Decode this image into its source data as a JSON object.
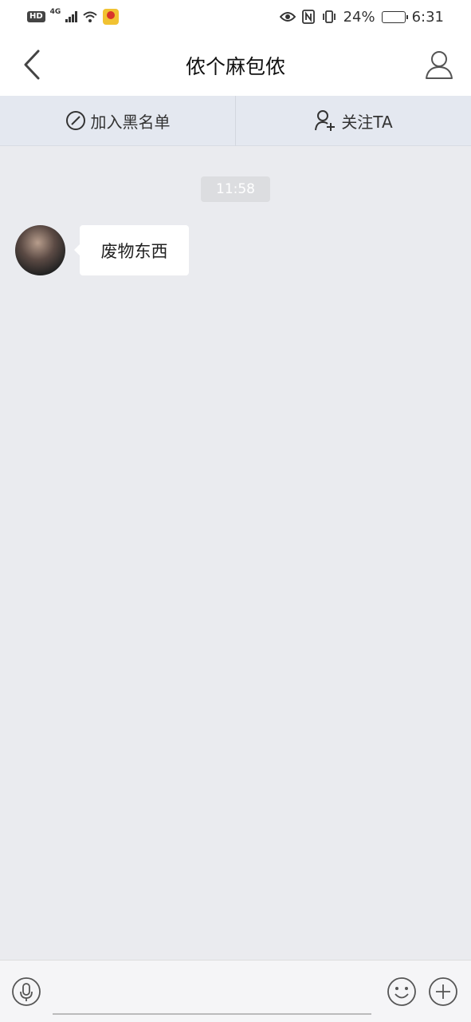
{
  "status_bar": {
    "hd_label": "HD",
    "network_label": "4G",
    "battery_percent": "24%",
    "battery_level": 0.24,
    "time": "6:31"
  },
  "header": {
    "title": "侬个麻包侬",
    "back_icon": "chevron-left-icon",
    "profile_icon": "user-outline-icon"
  },
  "actions": {
    "blacklist_label": "加入黑名单",
    "blacklist_icon": "ban-circle-icon",
    "follow_label": "关注TA",
    "follow_icon": "user-plus-icon"
  },
  "chat": {
    "timestamp": "11:58",
    "messages": [
      {
        "sender": "other",
        "text": "废物东西"
      }
    ]
  },
  "input_bar": {
    "voice_icon": "microphone-icon",
    "emoji_icon": "smiley-icon",
    "more_icon": "plus-circle-icon"
  },
  "colors": {
    "chat_background": "#eaebef",
    "action_bar_background": "#e4e8f0",
    "bubble_background": "#ffffff"
  }
}
